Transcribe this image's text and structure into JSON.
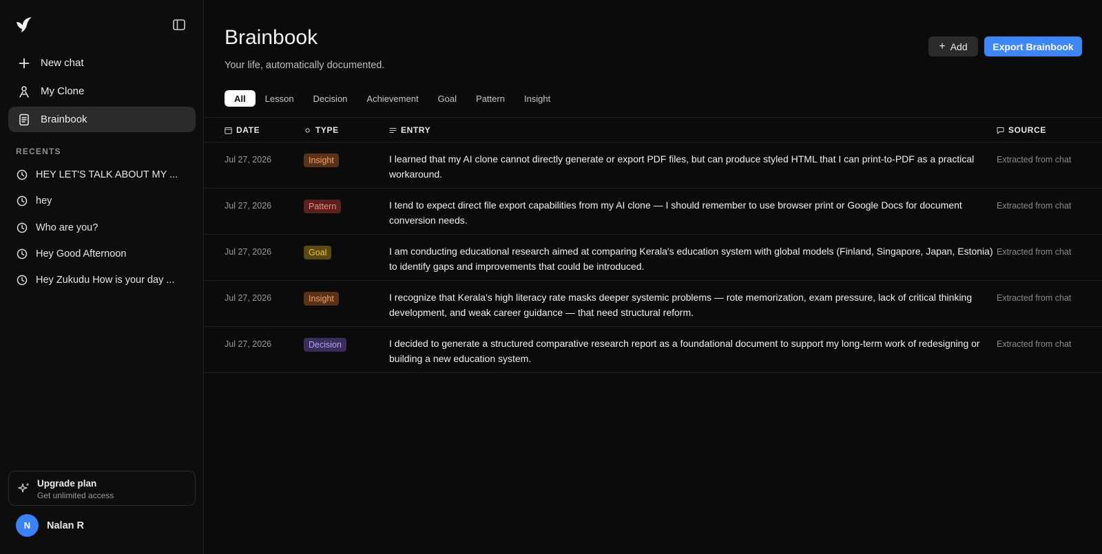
{
  "sidebar": {
    "nav": [
      {
        "label": "New chat",
        "icon": "plus-icon"
      },
      {
        "label": "My Clone",
        "icon": "person-icon"
      },
      {
        "label": "Brainbook",
        "icon": "notebook-icon",
        "active": true
      }
    ],
    "recents_label": "RECENTS",
    "recents": [
      "HEY LET'S TALK ABOUT MY ...",
      "hey",
      "Who are you?",
      "Hey Good Afternoon",
      "Hey Zukudu How is your day ..."
    ],
    "upgrade": {
      "title": "Upgrade plan",
      "subtitle": "Get unlimited access"
    },
    "user": {
      "initial": "N",
      "name": "Nalan R"
    }
  },
  "header": {
    "title": "Brainbook",
    "subtitle": "Your life, automatically documented.",
    "add_label": "Add",
    "export_label": "Export Brainbook"
  },
  "tabs": [
    "All",
    "Lesson",
    "Decision",
    "Achievement",
    "Goal",
    "Pattern",
    "Insight"
  ],
  "columns": {
    "date": "DATE",
    "type": "TYPE",
    "entry": "ENTRY",
    "source": "SOURCE"
  },
  "rows": [
    {
      "date": "Jul 27, 2026",
      "type": "Insight",
      "entry": "I learned that my AI clone cannot directly generate or export PDF files, but can produce styled HTML that I can print-to-PDF as a practical workaround.",
      "source": "Extracted from chat"
    },
    {
      "date": "Jul 27, 2026",
      "type": "Pattern",
      "entry": "I tend to expect direct file export capabilities from my AI clone — I should remember to use browser print or Google Docs for document conversion needs.",
      "source": "Extracted from chat"
    },
    {
      "date": "Jul 27, 2026",
      "type": "Goal",
      "entry": "I am conducting educational research aimed at comparing Kerala's education system with global models (Finland, Singapore, Japan, Estonia) to identify gaps and improvements that could be introduced.",
      "source": "Extracted from chat"
    },
    {
      "date": "Jul 27, 2026",
      "type": "Insight",
      "entry": "I recognize that Kerala's high literacy rate masks deeper systemic problems — rote memorization, exam pressure, lack of critical thinking development, and weak career guidance — that need structural reform.",
      "source": "Extracted from chat"
    },
    {
      "date": "Jul 27, 2026",
      "type": "Decision",
      "entry": "I decided to generate a structured comparative research report as a foundational document to support my long-term work of redesigning or building a new education system.",
      "source": "Extracted from chat"
    }
  ],
  "badge_colors": {
    "Insight": {
      "bg": "#5a3218",
      "fg": "#f0a06a"
    },
    "Pattern": {
      "bg": "#5a1f1f",
      "fg": "#f08a80"
    },
    "Goal": {
      "bg": "#5a4a12",
      "fg": "#e8c44a"
    },
    "Decision": {
      "bg": "#3a2d5e",
      "fg": "#b8a4f0"
    }
  },
  "accent": "#3d86f5"
}
